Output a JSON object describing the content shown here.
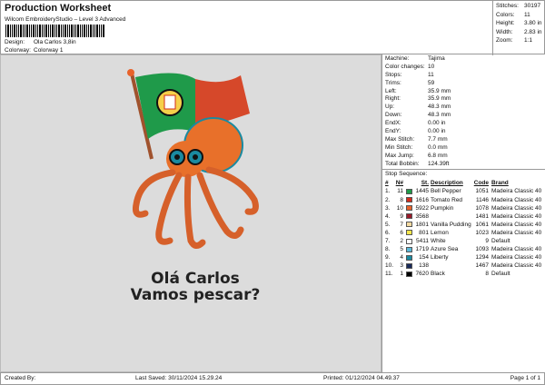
{
  "header": {
    "title": "Production Worksheet",
    "subtitle": "Wilcom EmbroideryStudio – Level 3 Advanced",
    "design_label": "Design:",
    "design_value": "Ola Carlos 3,8in",
    "colorway_label": "Colorway:",
    "colorway_value": "Colorway 1"
  },
  "stats": [
    {
      "k": "Stitches:",
      "v": "30197"
    },
    {
      "k": "Colors:",
      "v": "11"
    },
    {
      "k": "Height:",
      "v": "3.80 in"
    },
    {
      "k": "Width:",
      "v": "2.83 in"
    },
    {
      "k": "Zoom:",
      "v": "1:1"
    }
  ],
  "design_text": {
    "line1": "Olá Carlos",
    "line2": "Vamos pescar?"
  },
  "machine": [
    {
      "k": "Machine:",
      "v": "Tajima"
    },
    {
      "k": "Color changes:",
      "v": "10"
    },
    {
      "k": "Stops:",
      "v": "11"
    },
    {
      "k": "Trims:",
      "v": "59"
    },
    {
      "k": "Left:",
      "v": "35.9 mm"
    },
    {
      "k": "Right:",
      "v": "35.9 mm"
    },
    {
      "k": "Up:",
      "v": "48.3 mm"
    },
    {
      "k": "Down:",
      "v": "48.3 mm"
    },
    {
      "k": "EndX:",
      "v": "0.00 in"
    },
    {
      "k": "EndY:",
      "v": "0.00 in"
    },
    {
      "k": "Max Stitch:",
      "v": "7.7 mm"
    },
    {
      "k": "Min Stitch:",
      "v": "0.0 mm"
    },
    {
      "k": "Max Jump:",
      "v": "6.8 mm"
    },
    {
      "k": "Total Bobbin:",
      "v": "124.39ft"
    }
  ],
  "stop_sequence": {
    "title": "Stop Sequence:",
    "headers": [
      "#",
      "N#",
      "St.",
      "Description",
      "Code",
      "Brand"
    ],
    "rows": [
      {
        "i": "1.",
        "n": "11",
        "color": "#1f9a4a",
        "st": "1445",
        "desc": "Bell Pepper",
        "code": "1051",
        "brand": "Madeira Classic 40"
      },
      {
        "i": "2.",
        "n": "8",
        "color": "#d22a1a",
        "st": "1616",
        "desc": "Tomato Red",
        "code": "1146",
        "brand": "Madeira Classic 40"
      },
      {
        "i": "3.",
        "n": "10",
        "color": "#e8622a",
        "st": "5922",
        "desc": "Pumpkin",
        "code": "1078",
        "brand": "Madeira Classic 40"
      },
      {
        "i": "4.",
        "n": "9",
        "color": "#9a1a2a",
        "st": "3568",
        "desc": "",
        "code": "1481",
        "brand": "Madeira Classic 40"
      },
      {
        "i": "5.",
        "n": "7",
        "color": "#f3d9a0",
        "st": "1801",
        "desc": "Vanilla Pudding",
        "code": "1061",
        "brand": "Madeira Classic 40"
      },
      {
        "i": "6.",
        "n": "6",
        "color": "#f5e64a",
        "st": "801",
        "desc": "Lemon",
        "code": "1023",
        "brand": "Madeira Classic 40"
      },
      {
        "i": "7.",
        "n": "2",
        "color": "#ffffff",
        "st": "5411",
        "desc": "White",
        "code": "9",
        "brand": "Default"
      },
      {
        "i": "8.",
        "n": "5",
        "color": "#5ab8d8",
        "st": "1719",
        "desc": "Azure Sea",
        "code": "1093",
        "brand": "Madeira Classic 40"
      },
      {
        "i": "9.",
        "n": "4",
        "color": "#1a8aa0",
        "st": "154",
        "desc": "Liberty",
        "code": "1294",
        "brand": "Madeira Classic 40"
      },
      {
        "i": "10.",
        "n": "3",
        "color": "#1a2a5a",
        "st": "138",
        "desc": "",
        "code": "1467",
        "brand": "Madeira Classic 40"
      },
      {
        "i": "11.",
        "n": "1",
        "color": "#000000",
        "st": "7620",
        "desc": "Black",
        "code": "8",
        "brand": "Default"
      }
    ]
  },
  "footer": {
    "created": "Created By:",
    "saved": "Last Saved: 30/11/2024 15.29.24",
    "printed": "Printed: 01/12/2024 04.49.37",
    "page": "Page 1 of 1"
  }
}
